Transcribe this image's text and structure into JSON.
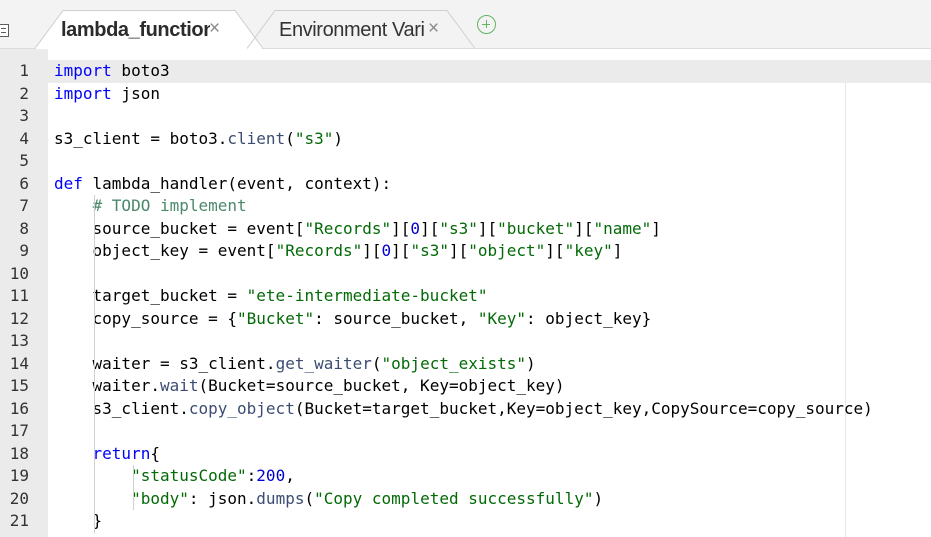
{
  "tabs": [
    {
      "label": "lambda_function",
      "active": true,
      "close": "×"
    },
    {
      "label": "Environment Vari",
      "active": false,
      "close": "×"
    }
  ],
  "add_tab_icon": "plus-circle-icon",
  "colors": {
    "keyword": "#0000ff",
    "string": "#036a07",
    "comment": "#4c886b",
    "number": "#0000cd",
    "add_tab": "#5fb564"
  },
  "editor": {
    "active_line": 1,
    "lines": [
      {
        "n": "1",
        "tokens": [
          [
            "kw",
            "import"
          ],
          [
            "t",
            " boto3"
          ]
        ]
      },
      {
        "n": "2",
        "tokens": [
          [
            "kw",
            "import"
          ],
          [
            "t",
            " json"
          ]
        ]
      },
      {
        "n": "3",
        "tokens": []
      },
      {
        "n": "4",
        "tokens": [
          [
            "t",
            "s3_client = boto3."
          ],
          [
            "fn",
            "client"
          ],
          [
            "t",
            "("
          ],
          [
            "str",
            "\"s3\""
          ],
          [
            "t",
            ")"
          ]
        ]
      },
      {
        "n": "5",
        "tokens": []
      },
      {
        "n": "6",
        "tokens": [
          [
            "kw",
            "def"
          ],
          [
            "t",
            " lambda_handler(event, context):"
          ]
        ]
      },
      {
        "n": "7",
        "tokens": [
          [
            "t",
            "    "
          ],
          [
            "cm",
            "# TODO implement"
          ]
        ]
      },
      {
        "n": "8",
        "tokens": [
          [
            "t",
            "    source_bucket = event["
          ],
          [
            "str",
            "\"Records\""
          ],
          [
            "t",
            "]["
          ],
          [
            "num",
            "0"
          ],
          [
            "t",
            "]["
          ],
          [
            "str",
            "\"s3\""
          ],
          [
            "t",
            "]["
          ],
          [
            "str",
            "\"bucket\""
          ],
          [
            "t",
            "]["
          ],
          [
            "str",
            "\"name\""
          ],
          [
            "t",
            "]"
          ]
        ]
      },
      {
        "n": "9",
        "tokens": [
          [
            "t",
            "    object_key = event["
          ],
          [
            "str",
            "\"Records\""
          ],
          [
            "t",
            "]["
          ],
          [
            "num",
            "0"
          ],
          [
            "t",
            "]["
          ],
          [
            "str",
            "\"s3\""
          ],
          [
            "t",
            "]["
          ],
          [
            "str",
            "\"object\""
          ],
          [
            "t",
            "]["
          ],
          [
            "str",
            "\"key\""
          ],
          [
            "t",
            "]"
          ]
        ]
      },
      {
        "n": "10",
        "tokens": []
      },
      {
        "n": "11",
        "tokens": [
          [
            "t",
            "    target_bucket = "
          ],
          [
            "str",
            "\"ete-intermediate-bucket\""
          ]
        ]
      },
      {
        "n": "12",
        "tokens": [
          [
            "t",
            "    copy_source = {"
          ],
          [
            "str",
            "\"Bucket\""
          ],
          [
            "t",
            ": source_bucket, "
          ],
          [
            "str",
            "\"Key\""
          ],
          [
            "t",
            ": object_key}"
          ]
        ]
      },
      {
        "n": "13",
        "tokens": []
      },
      {
        "n": "14",
        "tokens": [
          [
            "t",
            "    waiter = s3_client."
          ],
          [
            "fn",
            "get_waiter"
          ],
          [
            "t",
            "("
          ],
          [
            "str",
            "\"object_exists\""
          ],
          [
            "t",
            ")"
          ]
        ]
      },
      {
        "n": "15",
        "tokens": [
          [
            "t",
            "    waiter."
          ],
          [
            "fn",
            "wait"
          ],
          [
            "t",
            "(Bucket=source_bucket, Key=object_key)"
          ]
        ]
      },
      {
        "n": "16",
        "tokens": [
          [
            "t",
            "    s3_client."
          ],
          [
            "fn",
            "copy_object"
          ],
          [
            "t",
            "(Bucket=target_bucket,Key=object_key,CopySource=copy_source)"
          ]
        ]
      },
      {
        "n": "17",
        "tokens": []
      },
      {
        "n": "18",
        "tokens": [
          [
            "t",
            "    "
          ],
          [
            "kw",
            "return"
          ],
          [
            "t",
            "{"
          ]
        ]
      },
      {
        "n": "19",
        "tokens": [
          [
            "t",
            "        "
          ],
          [
            "str",
            "\"statusCode\""
          ],
          [
            "t",
            ":"
          ],
          [
            "num",
            "200"
          ],
          [
            "t",
            ","
          ]
        ]
      },
      {
        "n": "20",
        "tokens": [
          [
            "t",
            "        "
          ],
          [
            "str",
            "\"body\""
          ],
          [
            "t",
            ": json."
          ],
          [
            "fn",
            "dumps"
          ],
          [
            "t",
            "("
          ],
          [
            "str",
            "\"Copy completed successfully\""
          ],
          [
            "t",
            ")"
          ]
        ]
      },
      {
        "n": "21",
        "tokens": [
          [
            "t",
            "    }"
          ]
        ]
      }
    ]
  }
}
